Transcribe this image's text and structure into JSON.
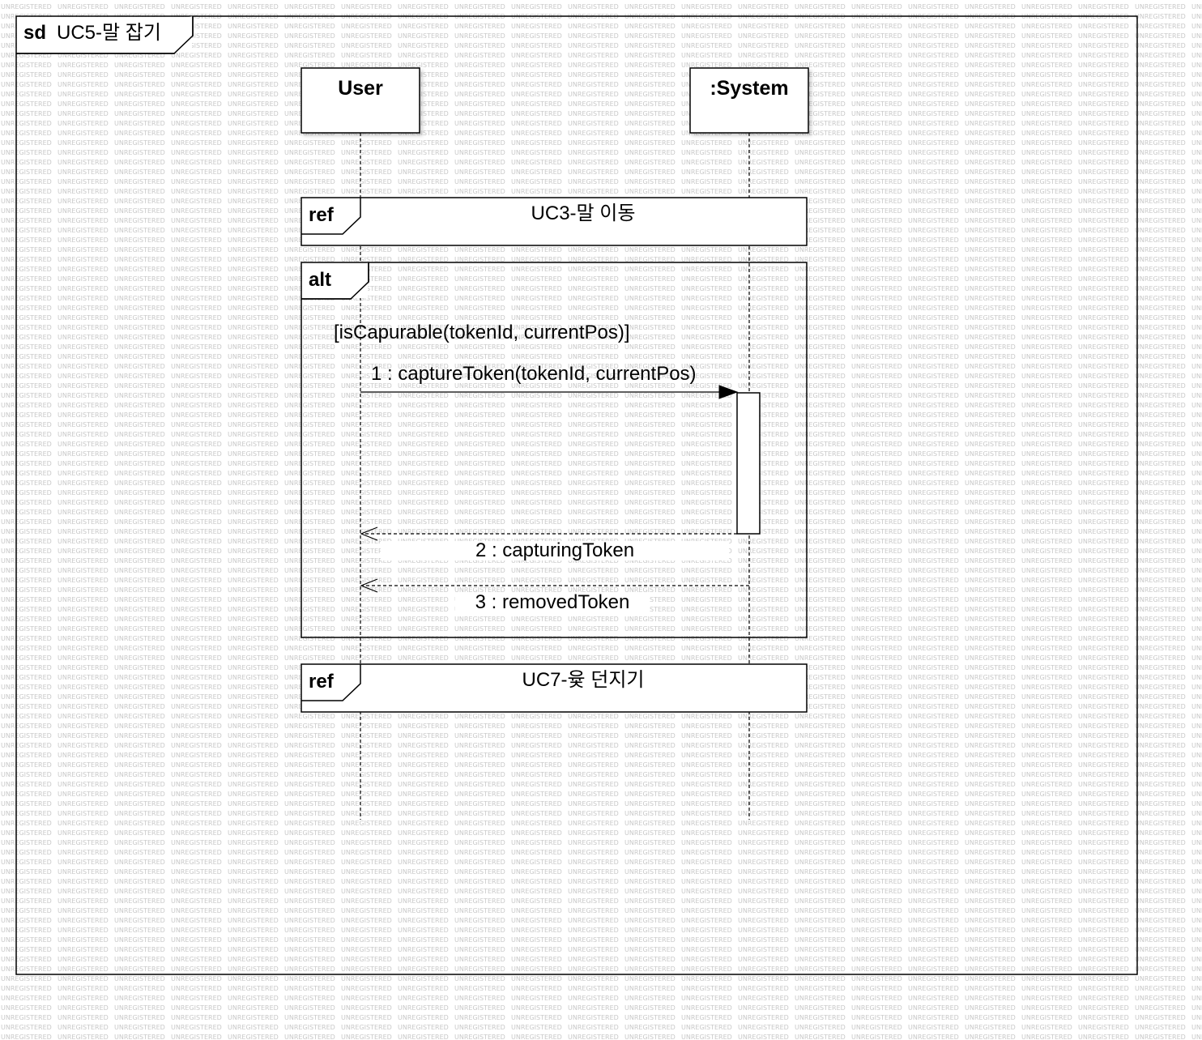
{
  "watermark_text": "UNREGISTERED",
  "frame": {
    "keyword": "sd",
    "title": "UC5-말 잡기"
  },
  "lifelines": [
    {
      "id": "user",
      "name": "User"
    },
    {
      "id": "system",
      "name": ":System"
    }
  ],
  "fragments": {
    "ref1": {
      "operator": "ref",
      "label": "UC3-말 이동"
    },
    "alt": {
      "operator": "alt",
      "guard": "[isCapurable(tokenId, currentPos)]"
    },
    "ref2": {
      "operator": "ref",
      "label": "UC7-윷 던지기"
    }
  },
  "messages": [
    {
      "label": "1 : captureToken(tokenId, currentPos)",
      "from": "User",
      "to": ":System",
      "kind": "synchronous"
    },
    {
      "label": "2 : capturingToken",
      "from": ":System",
      "to": "User",
      "kind": "reply"
    },
    {
      "label": "3 : removedToken",
      "from": ":System",
      "to": "User",
      "kind": "reply"
    }
  ],
  "colors": {
    "line": "#000000",
    "background": "#ffffff",
    "watermark": "#c8c8c8"
  }
}
